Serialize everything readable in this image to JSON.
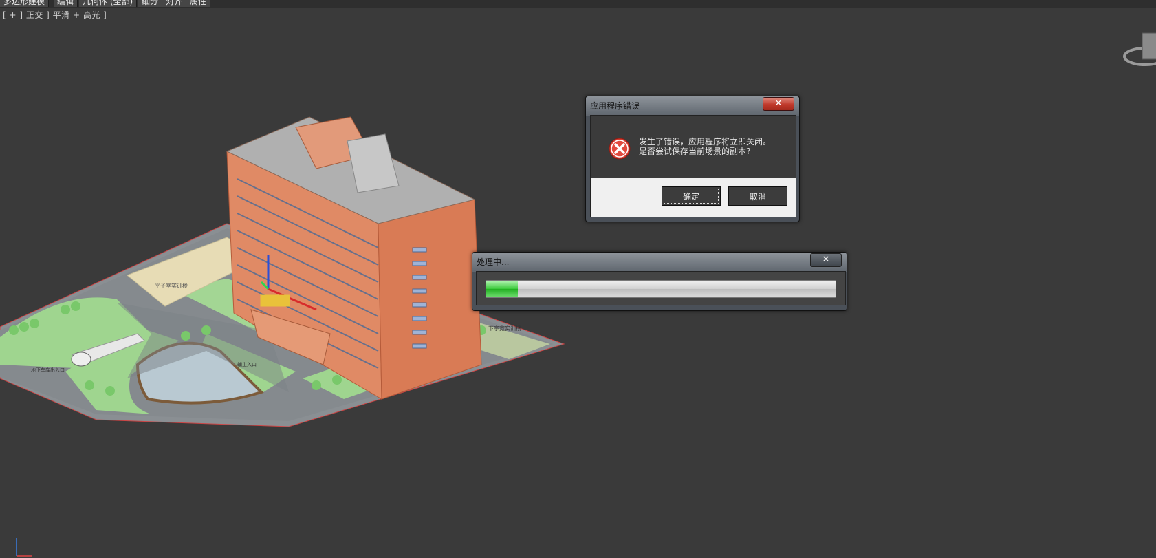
{
  "ribbon": {
    "tabs": [
      "多边形建模",
      "编辑",
      "几何体 (全部)",
      "细分",
      "对齐",
      "属性"
    ]
  },
  "viewport": {
    "label": "[ + ] 正交 ] 平滑 + 高光 ]"
  },
  "error_dialog": {
    "title": "应用程序错误",
    "close_glyph": "✕",
    "icon": "error-icon",
    "message_line1": "发生了错误，应用程序将立即关闭。",
    "message_line2": "是否尝试保存当前场景的副本?",
    "ok_label": "确定",
    "cancel_label": "取消"
  },
  "progress_dialog": {
    "title": "处理中...",
    "close_glyph": "✕",
    "progress_fraction": 0.09
  },
  "scene_labels": {
    "sign_top": "平子室实训楼",
    "sign_right": "下字宽实训楼",
    "sign_parking": "地下车库出入口",
    "sign_entrance": "辅主入口"
  },
  "colors": {
    "viewport_bg": "#3a3a3a",
    "building": "#e08a65",
    "lawn": "#9fd58f",
    "error_red": "#c0392b",
    "progress_green": "#38c838"
  }
}
